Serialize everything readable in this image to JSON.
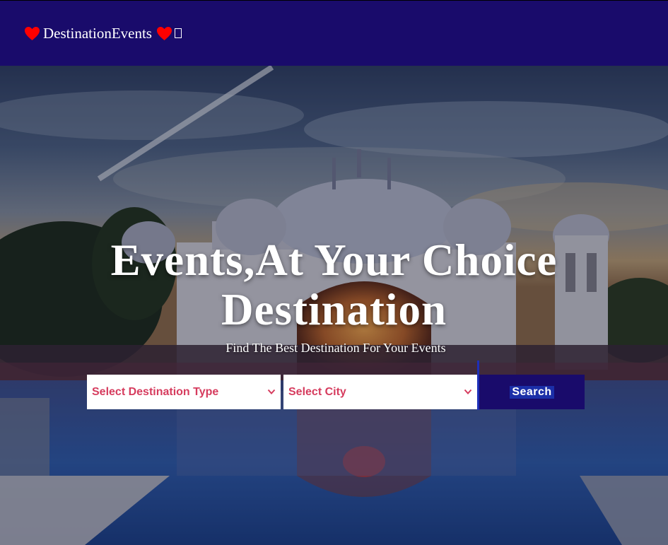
{
  "navbar": {
    "brand_text": "DestinationEvents",
    "left_icon": "heart-icon",
    "right_icon": "heart-icon",
    "trailing_icon": "missing-glyph-icon"
  },
  "hero": {
    "title": "Events,At Your Choice Destination",
    "subtitle": "Find The Best Destination For Your Events",
    "background": "palace-reflection-pool-photo"
  },
  "search": {
    "destination_type_selected": "Select Destination Type",
    "city_selected": "Select City",
    "button_label": "Search",
    "dropdown_icon": "chevron-down-icon"
  },
  "colors": {
    "navbar_bg": "#190b6b",
    "heart": "#ff0000",
    "select_text": "#d63c5e",
    "search_button_bg": "#190b6b",
    "search_label_bg": "#1b2fa8",
    "divider": "#1e2fb8"
  }
}
